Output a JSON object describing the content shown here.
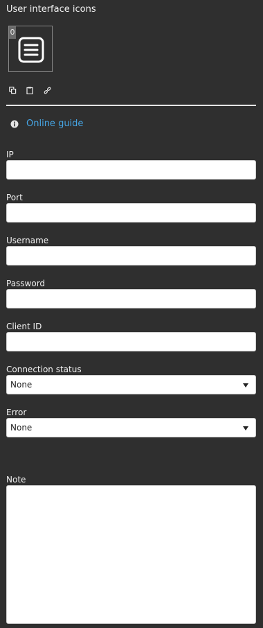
{
  "section": {
    "title": "User interface icons"
  },
  "icon_tile": {
    "index": "0",
    "icon": "menu-lines-icon"
  },
  "toolbar": {
    "icons": [
      "copy-icon",
      "paste-icon",
      "link-icon"
    ]
  },
  "guide": {
    "icon": "info-icon",
    "label": "Online guide"
  },
  "fields": {
    "ip": {
      "label": "IP",
      "value": ""
    },
    "port": {
      "label": "Port",
      "value": ""
    },
    "username": {
      "label": "Username",
      "value": ""
    },
    "password": {
      "label": "Password",
      "value": ""
    },
    "client_id": {
      "label": "Client ID",
      "value": ""
    },
    "connection_status": {
      "label": "Connection status",
      "value": "None"
    },
    "error": {
      "label": "Error",
      "value": "None"
    },
    "note": {
      "label": "Note",
      "value": ""
    }
  },
  "colors": {
    "background": "#2f2f2f",
    "link": "#46a6e6",
    "input_bg": "#ffffff"
  }
}
